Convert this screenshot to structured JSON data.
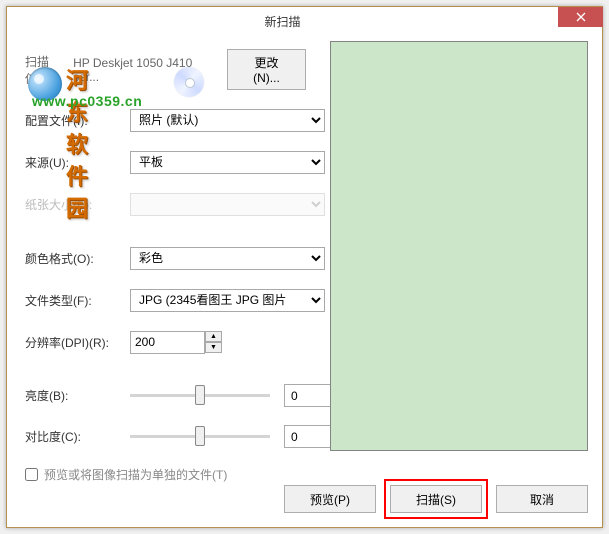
{
  "title": "新扫描",
  "watermark": {
    "cn": "河东软件园",
    "url": "www.pc0359.cn"
  },
  "scanner": {
    "label": "扫描仪:",
    "name": "HP Deskjet 1050 J410 ser...",
    "change_btn": "更改(N)..."
  },
  "fields": {
    "profile": {
      "label": "配置文件(I):",
      "value": "照片 (默认)"
    },
    "source": {
      "label": "来源(U):",
      "value": "平板"
    },
    "paper_size": {
      "label": "纸张大小(E):",
      "value": ""
    },
    "color_format": {
      "label": "颜色格式(O):",
      "value": "彩色"
    },
    "file_type": {
      "label": "文件类型(F):",
      "value": "JPG (2345看图王 JPG 图片"
    },
    "dpi": {
      "label": "分辨率(DPI)(R):",
      "value": "200"
    },
    "brightness": {
      "label": "亮度(B):",
      "value": "0"
    },
    "contrast": {
      "label": "对比度(C):",
      "value": "0"
    },
    "separate_files": {
      "label": "预览或将图像扫描为单独的文件(T)"
    }
  },
  "buttons": {
    "preview": "预览(P)",
    "scan": "扫描(S)",
    "cancel": "取消"
  }
}
